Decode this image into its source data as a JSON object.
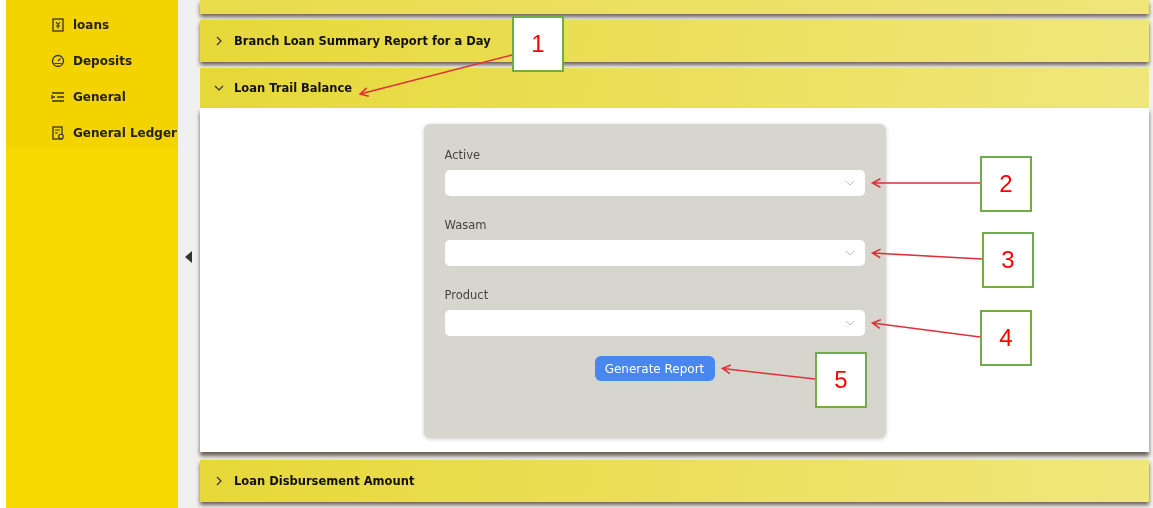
{
  "sidebar": {
    "items": [
      {
        "label": "loans",
        "kind": "loans"
      },
      {
        "label": "Deposits",
        "kind": "deposits"
      },
      {
        "label": "General",
        "kind": "general"
      },
      {
        "label": "General Ledger",
        "kind": "ledger"
      }
    ]
  },
  "accordions": [
    {
      "title": "Branch Loan Summary Report for a Day",
      "expanded": false
    },
    {
      "title": "Loan Trail Balance",
      "expanded": true,
      "form": {
        "fields": [
          {
            "label": "Active"
          },
          {
            "label": "Wasam"
          },
          {
            "label": "Product"
          }
        ],
        "button": "Generate Report"
      }
    },
    {
      "title": "Loan Disbursement Amount",
      "expanded": false
    }
  ],
  "callouts": [
    {
      "number": "1"
    },
    {
      "number": "2"
    },
    {
      "number": "3"
    },
    {
      "number": "4"
    },
    {
      "number": "5"
    }
  ]
}
